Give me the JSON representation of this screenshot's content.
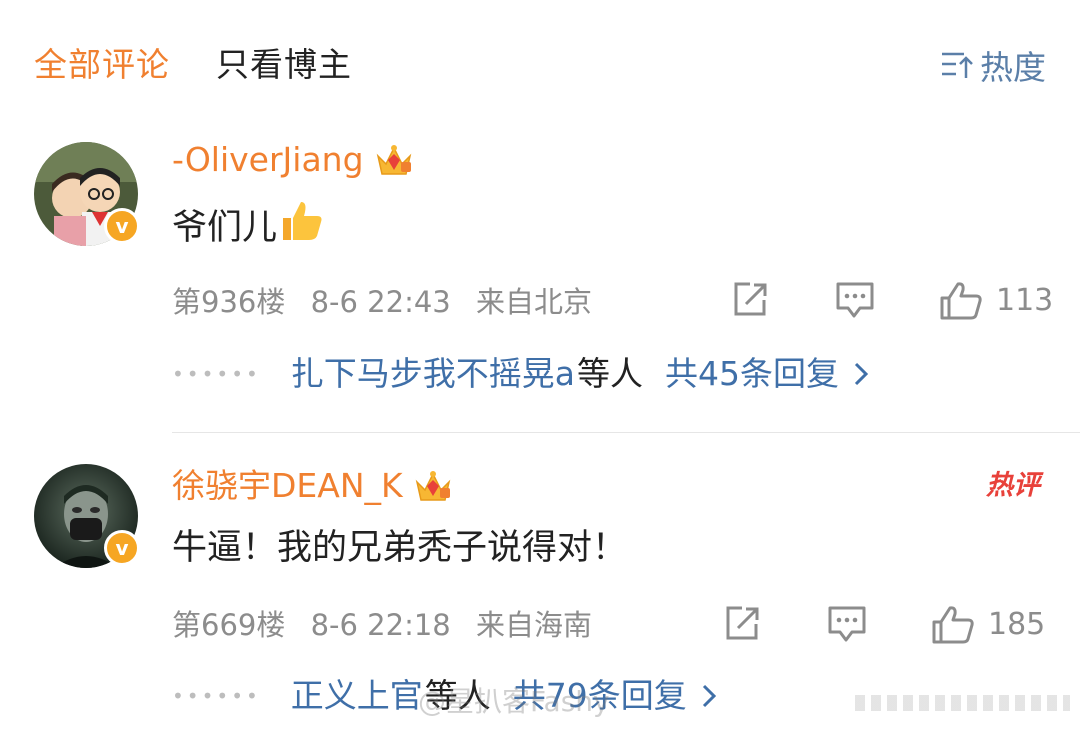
{
  "tabs": {
    "all_comments": "全部评论",
    "op_only": "只看博主",
    "sort_label": "热度"
  },
  "comments": [
    {
      "username": "-OliverJiang",
      "content": "爷们儿",
      "content_emoji": "👍",
      "floor": "第936楼",
      "time": "8-6 22:43",
      "location": "来自北京",
      "likes": "113",
      "reply_user": "扎下马步我不摇晃a",
      "reply_waiting": "等人",
      "reply_count": "共45条回复"
    },
    {
      "username": "徐骁宇DEAN_K",
      "content": "牛逼！我的兄弟秃子说得对！",
      "floor": "第669楼",
      "time": "8-6 22:18",
      "location": "来自海南",
      "likes": "185",
      "hot_badge": "热评",
      "reply_user": "正义上官",
      "reply_waiting": "等人",
      "reply_count": "共79条回复"
    }
  ],
  "watermark": "@星扒客Fashy",
  "colors": {
    "accent": "#f08030",
    "link": "#3f6fa8",
    "muted": "#8c8c8c",
    "hot": "#e8413a",
    "verified": "#f6a623"
  },
  "icons": {
    "sort": "sort-icon",
    "crown": "crown-icon",
    "share": "share-icon",
    "reply": "comment-icon",
    "like": "thumbs-up-icon",
    "chevron": "chevron-right-icon"
  }
}
